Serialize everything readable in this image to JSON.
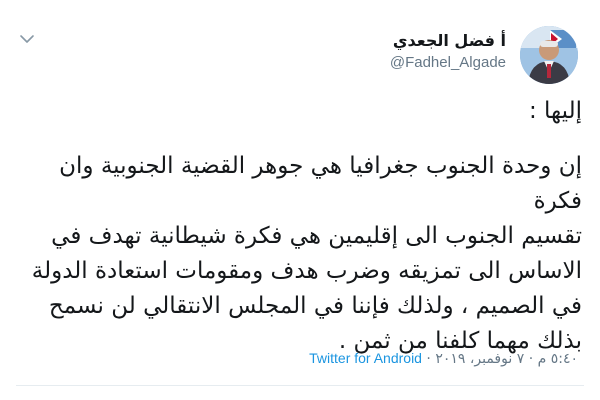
{
  "user": {
    "display_name": "أ فضل الجعدي",
    "handle": "@Fadhel_Algade"
  },
  "tweet": {
    "intro": "إليها :",
    "body": "إن وحدة الجنوب جغرافيا هي جوهر القضية الجنوبية وان فكرة\nتقسيم الجنوب الى إقليمين هي فكرة شيطانية تهدف في\nالاساس الى تمزيقه وضرب هدف ومقومات استعادة الدولة\nفي الصميم ، ولذلك فإننا في المجلس الانتقالي لن نسمح\nبذلك مهما كلفنا من ثمن ."
  },
  "meta": {
    "time": "٥:٤٠ م",
    "separator": "·",
    "date": "٧ نوفمبر، ٢٠١٩",
    "source": "Twitter for Android"
  },
  "icons": {
    "menu": "chevron-down-icon"
  },
  "colors": {
    "text": "#14171a",
    "secondary": "#657786",
    "link": "#1b95e0"
  }
}
